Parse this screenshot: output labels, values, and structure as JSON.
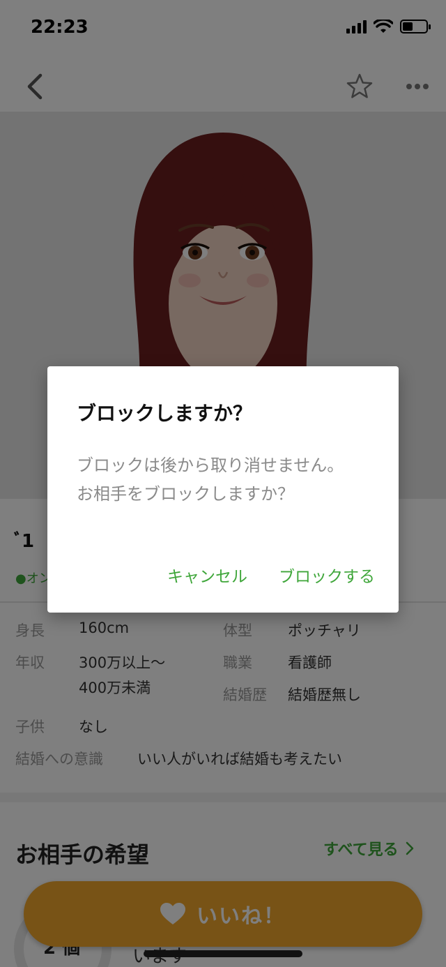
{
  "status_bar": {
    "time": "22:23"
  },
  "nav": {
    "back_icon": "chevron-left-icon",
    "star_icon": "star-outline-icon",
    "more_icon": "more-dots-icon"
  },
  "profile": {
    "name": "ﾞ1",
    "online_label": "●オン",
    "attributes": {
      "height": {
        "label": "身長",
        "value": "160cm"
      },
      "body_type": {
        "label": "体型",
        "value": "ポッチャリ"
      },
      "income": {
        "label": "年収",
        "value_line1": "300万以上～",
        "value_line2": "400万未満"
      },
      "job": {
        "label": "職業",
        "value": "看護師"
      },
      "marriage_history": {
        "label": "結婚歴",
        "value": "結婚歴無し"
      },
      "children": {
        "label": "子供",
        "value": "なし"
      },
      "marriage_intent": {
        "label": "結婚への意識",
        "value": "いい人がいれば結婚も考えたい"
      }
    }
  },
  "preferences": {
    "title": "お相手の希望",
    "see_all": "すべて見る",
    "badge_text": "2 個",
    "peek_text": "います"
  },
  "like_button": {
    "label": "いいね！",
    "icon": "heart-icon"
  },
  "dialog": {
    "title": "ブロックしますか？",
    "message": "ブロックは後から取り消せません。お相手をブロックしますか？",
    "cancel": "キャンセル",
    "confirm": "ブロックする"
  },
  "colors": {
    "accent_green": "#3fa63a",
    "like_orange": "#f1a72d",
    "overlay": "rgba(0,0,0,0.5)"
  }
}
